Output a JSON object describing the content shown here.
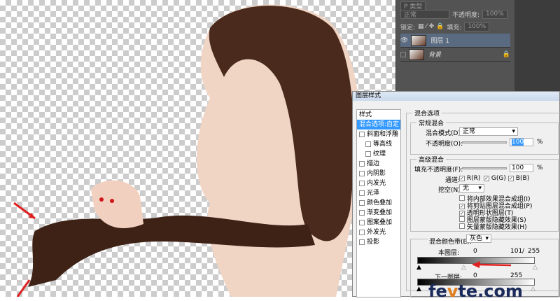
{
  "layers_panel": {
    "kind_filter": "P 类型",
    "blend_mode": "正常",
    "opacity_label": "不透明度:",
    "opacity_value": "100%",
    "lock_label": "锁定:",
    "fill_label": "填充:",
    "fill_value": "100%",
    "layers": [
      {
        "name": "图层 1",
        "selected": true,
        "visible": true
      },
      {
        "name": "背景",
        "selected": false,
        "visible": false
      }
    ]
  },
  "dialog": {
    "title": "图层样式",
    "styles": [
      {
        "label": "样式",
        "checkbox": false
      },
      {
        "label": "混合选项:自定",
        "checkbox": false,
        "selected": true
      },
      {
        "label": "斜面和浮雕",
        "checkbox": true
      },
      {
        "label": "等高线",
        "checkbox": true,
        "indent": true
      },
      {
        "label": "纹理",
        "checkbox": true,
        "indent": true
      },
      {
        "label": "描边",
        "checkbox": true
      },
      {
        "label": "内阴影",
        "checkbox": true
      },
      {
        "label": "内发光",
        "checkbox": true
      },
      {
        "label": "光泽",
        "checkbox": true
      },
      {
        "label": "颜色叠加",
        "checkbox": true
      },
      {
        "label": "渐变叠加",
        "checkbox": true
      },
      {
        "label": "图案叠加",
        "checkbox": true
      },
      {
        "label": "外发光",
        "checkbox": true
      },
      {
        "label": "投影",
        "checkbox": true
      }
    ],
    "blend_options_title": "混合选项",
    "general": {
      "title": "常规混合",
      "mode_label": "混合模式(D):",
      "mode_value": "正常",
      "opacity_label": "不透明度(O):",
      "opacity_value": "100",
      "percent": "%",
      "opacity_fraction": 1.0
    },
    "advanced": {
      "title": "高级混合",
      "fill_label": "填充不透明度(F):",
      "fill_value": "100",
      "percent": "%",
      "fill_fraction": 1.0,
      "channels_label": "通道:",
      "channels": [
        {
          "label": "R(R)",
          "checked": true
        },
        {
          "label": "G(G)",
          "checked": true
        },
        {
          "label": "B(B)",
          "checked": true
        }
      ],
      "knockout_label": "挖空(N):",
      "knockout_value": "无",
      "options": [
        {
          "label": "将内部效果混合成组(I)",
          "checked": false
        },
        {
          "label": "将剪贴图层混合成组(P)",
          "checked": true
        },
        {
          "label": "透明形状图层(T)",
          "checked": true
        },
        {
          "label": "图层蒙版隐藏效果(S)",
          "checked": false
        },
        {
          "label": "矢量蒙版隐藏效果(H)",
          "checked": false
        }
      ]
    },
    "blend_if": {
      "label": "混合颜色带(E):",
      "value": "灰色",
      "this_layer_label": "本图层:",
      "this_low": "0",
      "this_high": "101",
      "slash": "/",
      "this_high2": "255",
      "underlying_label": "下一图层:",
      "under_low": "0",
      "under_high": "255"
    }
  },
  "watermark": "fevte.com",
  "colors": {
    "selection": "#3399ff",
    "arrow": "#e02020",
    "hair": "#4a2a1c"
  }
}
